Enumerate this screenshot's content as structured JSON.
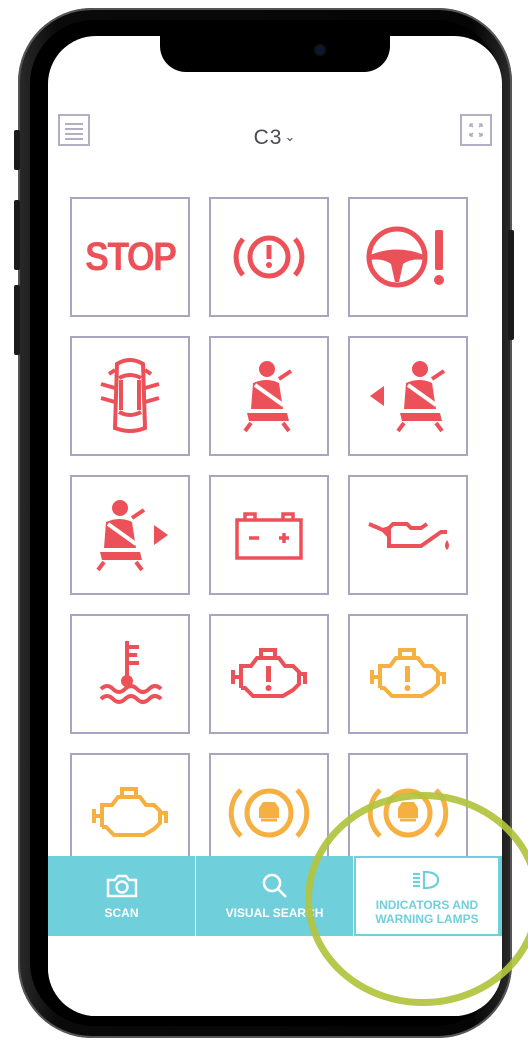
{
  "header": {
    "model": "C3",
    "menu_icon": "hamburger-icon",
    "expand_icon": "expand-arrows-icon"
  },
  "warning_lights": [
    {
      "id": "stop",
      "label": "STOP",
      "color": "#ec5058"
    },
    {
      "id": "brake",
      "icon": "brake-warning-icon",
      "color": "#ec5058"
    },
    {
      "id": "steering",
      "icon": "power-steering-warning-icon",
      "color": "#ec5058"
    },
    {
      "id": "door",
      "icon": "door-open-icon",
      "color": "#ec5058"
    },
    {
      "id": "seatbelt",
      "icon": "seatbelt-icon",
      "color": "#ec5058"
    },
    {
      "id": "seatbelt-left",
      "icon": "seatbelt-left-passenger-icon",
      "color": "#ec5058"
    },
    {
      "id": "seatbelt-right",
      "icon": "seatbelt-right-passenger-icon",
      "color": "#ec5058"
    },
    {
      "id": "battery",
      "icon": "battery-charge-icon",
      "color": "#ec5058"
    },
    {
      "id": "oil",
      "icon": "oil-pressure-icon",
      "color": "#ec5058"
    },
    {
      "id": "coolant",
      "icon": "coolant-temperature-icon",
      "color": "#ec5058"
    },
    {
      "id": "engine-red",
      "icon": "engine-fault-red-icon",
      "color": "#ec5058"
    },
    {
      "id": "engine-amber",
      "icon": "engine-fault-amber-icon",
      "color": "#f6b042"
    },
    {
      "id": "check-engine",
      "icon": "check-engine-icon",
      "color": "#f6b042"
    },
    {
      "id": "brake-pad-1",
      "icon": "brake-pad-wear-icon",
      "color": "#f6b042"
    },
    {
      "id": "brake-pad-2",
      "icon": "brake-pad-wear-icon",
      "color": "#f6b042"
    }
  ],
  "tabs": {
    "scan": {
      "label": "SCAN",
      "icon": "camera-icon"
    },
    "visual": {
      "label": "VISUAL SEARCH",
      "icon": "search-icon"
    },
    "indicators": {
      "label": "INDICATORS AND\nWARNING LAMPS",
      "icon": "headlight-icon"
    }
  },
  "colors": {
    "red": "#ec5058",
    "amber": "#f6b042",
    "teal": "#6fd0dc",
    "tile_border": "#a9a4bf",
    "highlight": "#b2c33e"
  }
}
